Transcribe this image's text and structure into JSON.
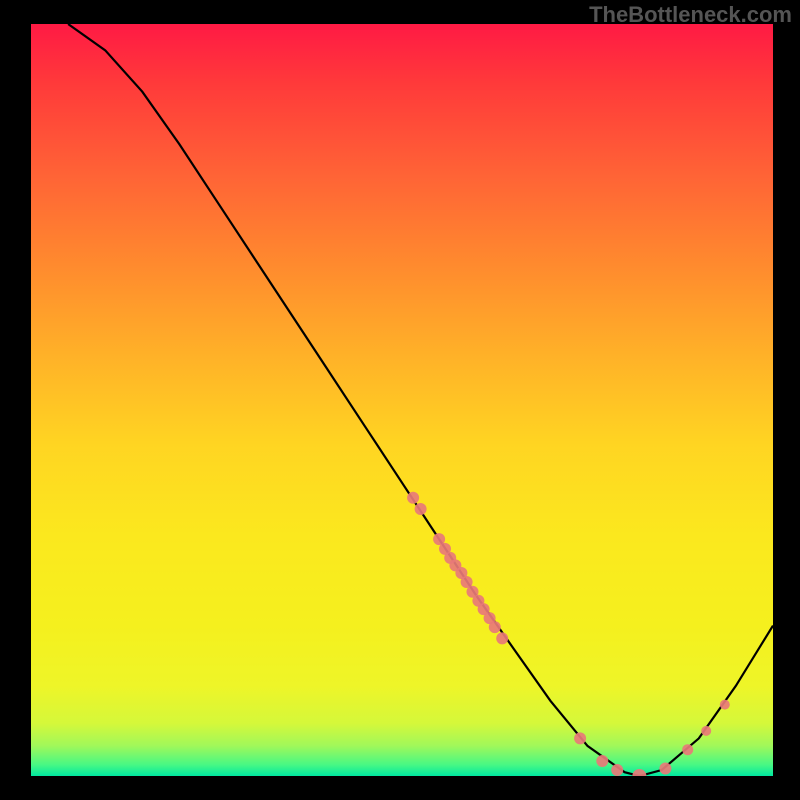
{
  "watermark": "TheBottleneck.com",
  "chart_data": {
    "type": "line",
    "title": "",
    "xlabel": "",
    "ylabel": "",
    "xlim": [
      0,
      100
    ],
    "ylim": [
      0,
      100
    ],
    "curve": {
      "name": "bottleneck-curve",
      "x": [
        5,
        10,
        15,
        20,
        25,
        30,
        35,
        40,
        45,
        50,
        55,
        60,
        65,
        70,
        75,
        80,
        82,
        85,
        90,
        95,
        100
      ],
      "y": [
        100,
        96.5,
        91,
        84,
        76.5,
        69,
        61.5,
        54,
        46.5,
        39,
        31.5,
        24,
        17,
        10,
        4,
        0.5,
        0,
        0.8,
        5,
        12,
        20
      ]
    },
    "scatter": {
      "name": "data-points",
      "color": "#e87a78",
      "points": [
        {
          "x": 51.5,
          "y": 37,
          "r": 6
        },
        {
          "x": 52.5,
          "y": 35.5,
          "r": 6
        },
        {
          "x": 55,
          "y": 31.5,
          "r": 6
        },
        {
          "x": 55.8,
          "y": 30.2,
          "r": 6
        },
        {
          "x": 56.5,
          "y": 29,
          "r": 6
        },
        {
          "x": 57.2,
          "y": 28,
          "r": 6
        },
        {
          "x": 58,
          "y": 27,
          "r": 6
        },
        {
          "x": 58.7,
          "y": 25.8,
          "r": 6
        },
        {
          "x": 59.5,
          "y": 24.5,
          "r": 6
        },
        {
          "x": 60.3,
          "y": 23.3,
          "r": 6
        },
        {
          "x": 61,
          "y": 22.2,
          "r": 6
        },
        {
          "x": 61.8,
          "y": 21,
          "r": 6
        },
        {
          "x": 62.5,
          "y": 19.8,
          "r": 6
        },
        {
          "x": 63.5,
          "y": 18.3,
          "r": 6
        },
        {
          "x": 74,
          "y": 5,
          "r": 6
        },
        {
          "x": 77,
          "y": 2,
          "r": 6
        },
        {
          "x": 79,
          "y": 0.8,
          "r": 6
        },
        {
          "x": 82,
          "y": 0,
          "r": 7
        },
        {
          "x": 85.5,
          "y": 1,
          "r": 6
        },
        {
          "x": 88.5,
          "y": 3.5,
          "r": 5.5
        },
        {
          "x": 91,
          "y": 6,
          "r": 5
        },
        {
          "x": 93.5,
          "y": 9.5,
          "r": 5
        }
      ]
    },
    "gradient_stops": [
      {
        "pos": 0,
        "color": "#ff1a44"
      },
      {
        "pos": 0.5,
        "color": "#ffd522"
      },
      {
        "pos": 0.96,
        "color": "#a0f85a"
      },
      {
        "pos": 1,
        "color": "#00e8a0"
      }
    ]
  }
}
